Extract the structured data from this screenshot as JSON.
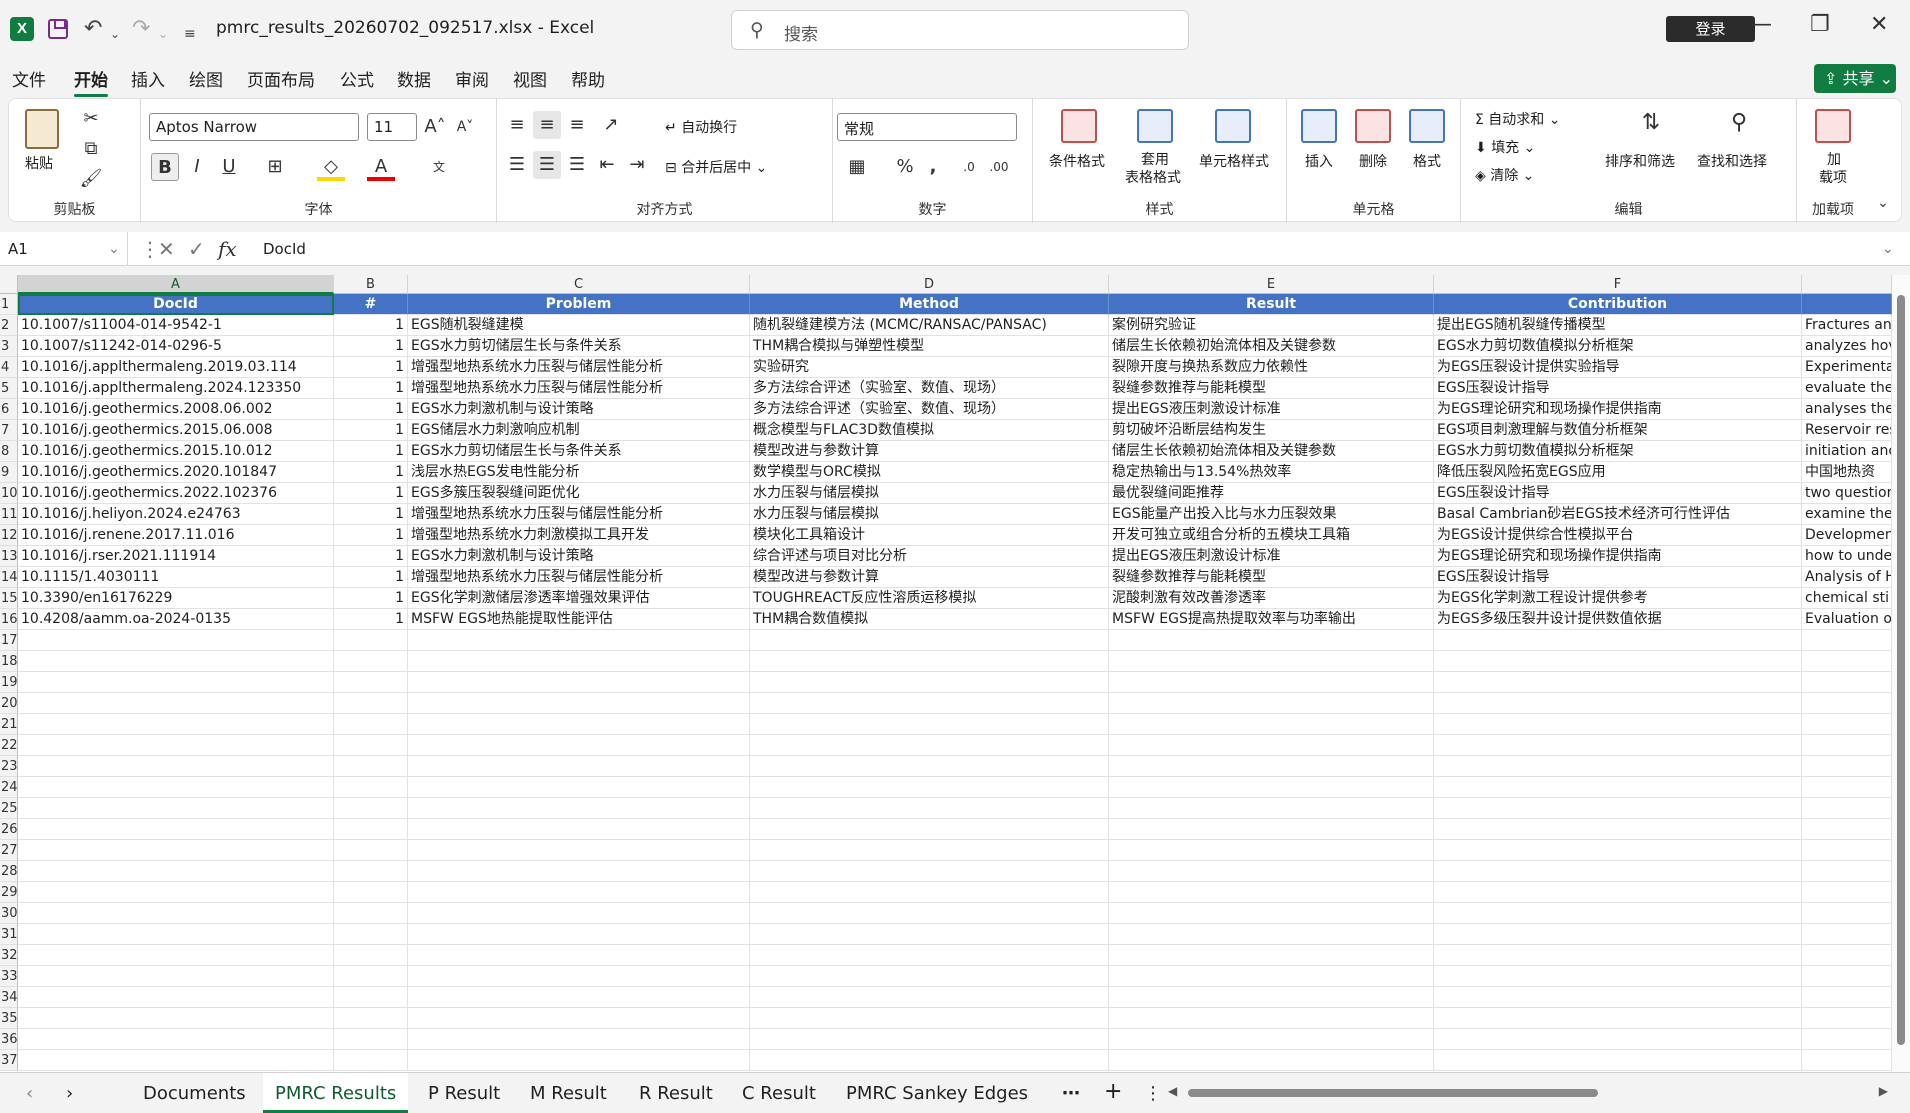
{
  "window": {
    "title": "pmrc_results_20260702_092517.xlsx  -  Excel",
    "search_placeholder": "搜索",
    "login_label": "登录"
  },
  "menu": [
    "文件",
    "开始",
    "插入",
    "绘图",
    "页面布局",
    "公式",
    "数据",
    "审阅",
    "视图",
    "帮助"
  ],
  "share_label": "共享",
  "ribbon": {
    "clipboard": {
      "label": "剪贴板",
      "paste": "粘贴"
    },
    "font": {
      "label": "字体",
      "name": "Aptos Narrow",
      "size": "11"
    },
    "alignment": {
      "label": "对齐方式",
      "wrap": "自动换行",
      "merge": "合并后居中"
    },
    "number": {
      "label": "数字",
      "format": "常规"
    },
    "styles": {
      "label": "样式",
      "conditional": "条件格式",
      "table_l1": "套用",
      "table_l2": "表格格式",
      "cell_styles": "单元格样式"
    },
    "cells": {
      "label": "单元格",
      "insert": "插入",
      "delete": "删除",
      "format": "格式"
    },
    "editing": {
      "label": "编辑",
      "autosum": "自动求和",
      "fill": "填充",
      "clear": "清除",
      "sort": "排序和筛选",
      "find": "查找和选择"
    },
    "addins": {
      "label": "加载项",
      "l1": "加",
      "l2": "载项"
    }
  },
  "formula_bar": {
    "name_box": "A1",
    "content": "DocId",
    "fx": "fx"
  },
  "columns": [
    "A",
    "B",
    "C",
    "D",
    "E",
    "F"
  ],
  "header_row": [
    "DocId",
    "#",
    "Problem",
    "Method",
    "Result",
    "Contribution"
  ],
  "rows": [
    [
      "10.1007/s11004-014-9542-1",
      "1",
      "EGS随机裂缝建模",
      "随机裂缝建模方法 (MCMC/RANSAC/PANSAC)",
      "案例研究验证",
      "提出EGS随机裂缝传播模型",
      "Fractures an"
    ],
    [
      "10.1007/s11242-014-0296-5",
      "1",
      "EGS水力剪切储层生长与条件关系",
      "THM耦合模拟与弹塑性模型",
      "储层生长依赖初始流体相及关键参数",
      "EGS水力剪切数值模拟分析框架",
      "analyzes hov"
    ],
    [
      "10.1016/j.applthermaleng.2019.03.114",
      "1",
      "增强型地热系统水力压裂与储层性能分析",
      "实验研究",
      "裂隙开度与换热系数应力依赖性",
      "为EGS压裂设计提供实验指导",
      "Experimenta"
    ],
    [
      "10.1016/j.applthermaleng.2024.123350",
      "1",
      "增强型地热系统水力压裂与储层性能分析",
      "多方法综合评述（实验室、数值、现场）",
      "裂缝参数推荐与能耗模型",
      "EGS压裂设计指导",
      "evaluate the"
    ],
    [
      "10.1016/j.geothermics.2008.06.002",
      "1",
      "EGS水力刺激机制与设计策略",
      "多方法综合评述（实验室、数值、现场）",
      "提出EGS液压刺激设计标准",
      "为EGS理论研究和现场操作提供指南",
      "analyses the"
    ],
    [
      "10.1016/j.geothermics.2015.06.008",
      "1",
      "EGS储层水力刺激响应机制",
      "概念模型与FLAC3D数值模拟",
      "剪切破坏沿断层结构发生",
      "EGS项目刺激理解与数值分析框架",
      "Reservoir res"
    ],
    [
      "10.1016/j.geothermics.2015.10.012",
      "1",
      "EGS水力剪切储层生长与条件关系",
      "模型改进与参数计算",
      "储层生长依赖初始流体相及关键参数",
      "EGS水力剪切数值模拟分析框架",
      "initiation anc"
    ],
    [
      "10.1016/j.geothermics.2020.101847",
      "1",
      "浅层水热EGS发电性能分析",
      "数学模型与ORC模拟",
      "稳定热输出与13.54%热效率",
      "降低压裂风险拓宽EGS应用",
      "中国地热资"
    ],
    [
      "10.1016/j.geothermics.2022.102376",
      "1",
      "EGS多簇压裂裂缝间距优化",
      "水力压裂与储层模拟",
      "最优裂缝间距推荐",
      "EGS压裂设计指导",
      "two questior"
    ],
    [
      "10.1016/j.heliyon.2024.e24763",
      "1",
      "增强型地热系统水力压裂与储层性能分析",
      "水力压裂与储层模拟",
      "EGS能量产出投入比与水力压裂效果",
      "Basal Cambrian砂岩EGS技术经济可行性评估",
      "examine the"
    ],
    [
      "10.1016/j.renene.2017.11.016",
      "1",
      "增强型地热系统水力刺激模拟工具开发",
      "模块化工具箱设计",
      "开发可独立或组合分析的五模块工具箱",
      "为EGS设计提供综合性模拟平台",
      "Developmen"
    ],
    [
      "10.1016/j.rser.2021.111914",
      "1",
      "EGS水力刺激机制与设计策略",
      "综合评述与项目对比分析",
      "提出EGS液压刺激设计标准",
      "为EGS理论研究和现场操作提供指南",
      "how to under"
    ],
    [
      "10.1115/1.4030111",
      "1",
      "增强型地热系统水力压裂与储层性能分析",
      "模型改进与参数计算",
      "裂缝参数推荐与能耗模型",
      "EGS压裂设计指导",
      "Analysis of H"
    ],
    [
      "10.3390/en16176229",
      "1",
      "EGS化学刺激储层渗透率增强效果评估",
      "TOUGHREACT反应性溶质运移模拟",
      "泥酸刺激有效改善渗透率",
      "为EGS化学刺激工程设计提供参考",
      "chemical sti"
    ],
    [
      "10.4208/aamm.oa-2024-0135",
      "1",
      "MSFW EGS地热能提取性能评估",
      "THM耦合数值模拟",
      "MSFW EGS提高热提取效率与功率输出",
      "为EGS多级压裂井设计提供数值依据",
      "Evaluation o"
    ]
  ],
  "row_numbers": [
    "1",
    "2",
    "3",
    "4",
    "5",
    "6",
    "7",
    "8",
    "9",
    "10",
    "11",
    "12",
    "13",
    "14",
    "15",
    "16",
    "17",
    "18",
    "19",
    "20",
    "21",
    "22",
    "23",
    "24",
    "25",
    "26",
    "27",
    "28",
    "29",
    "30",
    "31",
    "32",
    "33",
    "34",
    "35",
    "36",
    "37"
  ],
  "tabs": [
    "Documents",
    "PMRC Results",
    "P Result",
    "M Result",
    "R Result",
    "C Result",
    "PMRC Sankey Edges"
  ],
  "active_tab": "PMRC Results",
  "colors": {
    "accent": "#107c41",
    "header_fill": "#4472c4"
  }
}
